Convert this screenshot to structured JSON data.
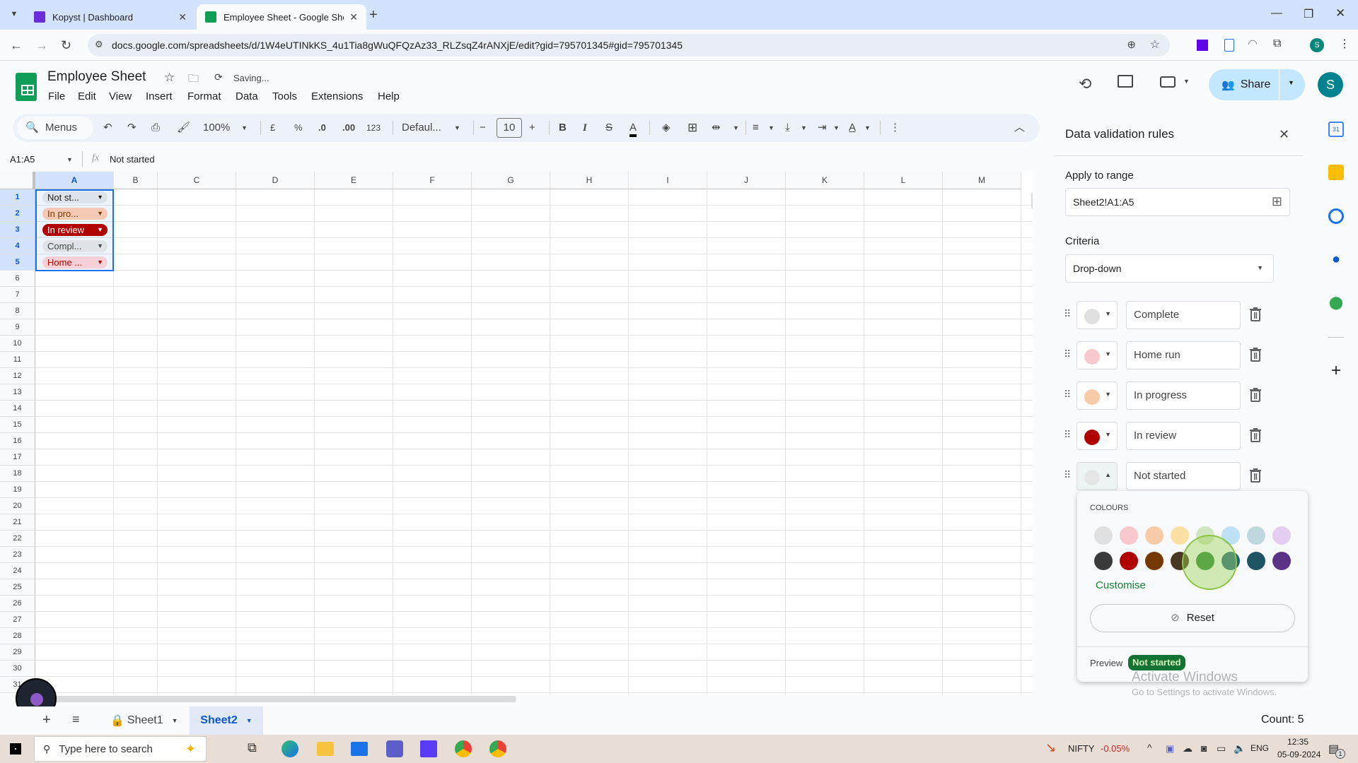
{
  "browser": {
    "tabs": [
      {
        "label": "Kopyst | Dashboard",
        "active": false
      },
      {
        "label": "Employee Sheet - Google Sheet",
        "active": true
      }
    ],
    "url": "docs.google.com/spreadsheets/d/1W4eUTINkKS_4u1Tia8gWuQFQzAz33_RLZsqZ4rANXjE/edit?gid=795701345#gid=795701345",
    "profile_initial": "S"
  },
  "doc": {
    "title": "Employee Sheet",
    "status": "Saving...",
    "menus": [
      "File",
      "Edit",
      "View",
      "Insert",
      "Format",
      "Data",
      "Tools",
      "Extensions",
      "Help"
    ],
    "share_label": "Share",
    "avatar_initial": "S"
  },
  "toolbar": {
    "search_label": "Menus",
    "zoom": "100%",
    "currency": "£",
    "percent": "%",
    "dec_decrease": ".0",
    "dec_increase": ".00",
    "format_123": "123",
    "font": "Defaul...",
    "font_size": "10"
  },
  "formula_bar": {
    "name_box": "A1:A5",
    "fx": "fx",
    "content": "Not started"
  },
  "grid": {
    "columns": [
      "A",
      "B",
      "C",
      "D",
      "E",
      "F",
      "G",
      "H",
      "I",
      "J",
      "K",
      "L",
      "M"
    ],
    "rows": [
      "1",
      "2",
      "3",
      "4",
      "5",
      "6",
      "7",
      "8",
      "9",
      "10",
      "11",
      "12",
      "13",
      "14",
      "15",
      "16",
      "17",
      "18",
      "19",
      "20",
      "21",
      "22",
      "23",
      "24",
      "25",
      "26",
      "27",
      "28",
      "29",
      "30",
      "31"
    ],
    "cells": [
      {
        "row": 1,
        "text": "Not st...",
        "bg": "#dde3ea",
        "fg": "#1f1f1f"
      },
      {
        "row": 2,
        "text": "In pro...",
        "bg": "#f6c9b4",
        "fg": "#753800"
      },
      {
        "row": 3,
        "text": "In review",
        "bg": "#b10202",
        "fg": "#ffffff"
      },
      {
        "row": 4,
        "text": "Compl...",
        "bg": "#dde3e6",
        "fg": "#444746"
      },
      {
        "row": 5,
        "text": "Home ...",
        "bg": "#f6d0d6",
        "fg": "#b10202"
      }
    ]
  },
  "panel": {
    "title": "Data validation rules",
    "range_label": "Apply to range",
    "range_value": "Sheet2!A1:A5",
    "criteria_label": "Criteria",
    "criteria_value": "Drop-down",
    "rules": [
      {
        "value": "Complete",
        "color": "#e0e0e0"
      },
      {
        "value": "Home run",
        "color": "#f7c8cc"
      },
      {
        "value": "In progress",
        "color": "#f8cba8"
      },
      {
        "value": "In review",
        "color": "#b10202"
      },
      {
        "value": "Not started",
        "color": "#e6e6e6"
      }
    ]
  },
  "color_popup": {
    "heading": "COLOURS",
    "light_row": [
      "#e0e0e0",
      "#f7c8cc",
      "#f8cba8",
      "#fae0a3",
      "#d0e6c1",
      "#bde0f5",
      "#bfd8de",
      "#e3cdf0"
    ],
    "dark_row": [
      "#3a3a3a",
      "#b10202",
      "#753800",
      "#473821",
      "#288437",
      "#21637e",
      "#1e5463",
      "#5a3286"
    ],
    "customise_label": "Customise",
    "reset_label": "Reset",
    "preview_label": "Preview",
    "preview_chip": "Not started",
    "preview_bg": "#137333",
    "preview_fg": "#d4edbc"
  },
  "sheet_tabs": [
    {
      "label": "Sheet1",
      "locked": true,
      "active": false
    },
    {
      "label": "Sheet2",
      "locked": false,
      "active": true
    }
  ],
  "status": {
    "count": "Count: 5"
  },
  "watermark": {
    "line1": "Activate Windows",
    "line2": "Go to Settings to activate Windows."
  },
  "taskbar": {
    "search_placeholder": "Type here to search",
    "ticker_name": "NIFTY",
    "ticker_change": "-0.05%",
    "lang": "ENG",
    "time": "12:35",
    "date": "05-09-2024",
    "notif_count": "1"
  }
}
